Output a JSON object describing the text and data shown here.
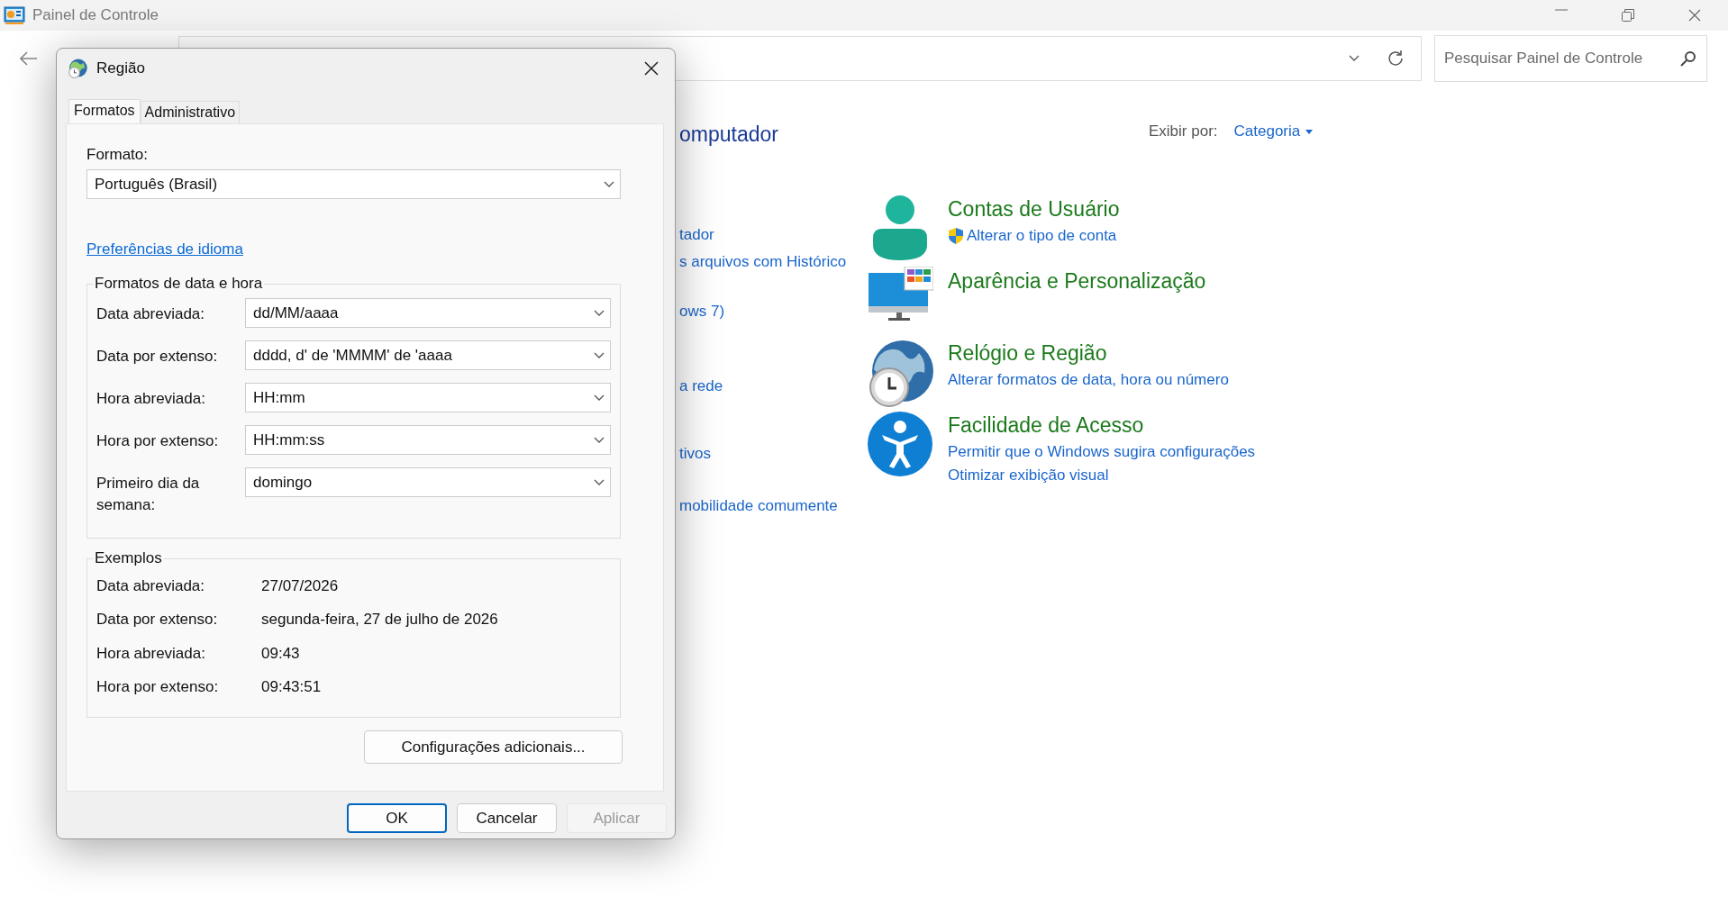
{
  "window": {
    "title": "Painel de Controle"
  },
  "search": {
    "placeholder": "Pesquisar Painel de Controle"
  },
  "heading": "omputador",
  "left_links": [
    "tador",
    "s arquivos com Histórico",
    "ows 7)",
    "a rede",
    "tivos",
    "mobilidade comumente"
  ],
  "view_by": {
    "label": "Exibir por:",
    "value": "Categoria"
  },
  "categories": [
    {
      "kind": "user",
      "title": "Contas de Usuário",
      "links": [
        {
          "text": "Alterar o tipo de conta",
          "shield": true
        }
      ]
    },
    {
      "kind": "display",
      "title": "Aparência e Personalização"
    },
    {
      "kind": "clock",
      "title": "Relógio e Região",
      "links": [
        {
          "text": "Alterar formatos de data, hora ou número",
          "shield": false
        }
      ]
    },
    {
      "kind": "access",
      "title": "Facilidade de Acesso",
      "links": [
        {
          "text": "Permitir que o Windows sugira configurações",
          "shield": false
        },
        {
          "text": "Otimizar exibição visual",
          "shield": false
        }
      ]
    }
  ],
  "dialog": {
    "title": "Região",
    "tabs": [
      {
        "label": "Formatos",
        "selected": true
      },
      {
        "label": "Administrativo",
        "selected": false
      }
    ],
    "format_label": "Formato:",
    "format_value": "Português (Brasil)",
    "link": "Preferências de idioma",
    "formats_group": {
      "title": "Formatos de data e hora",
      "rows": [
        {
          "label": "Data abreviada:",
          "value": "dd/MM/aaaa"
        },
        {
          "label": "Data por extenso:",
          "value": "dddd, d' de 'MMMM' de 'aaaa"
        },
        {
          "label": "Hora abreviada:",
          "value": "HH:mm"
        },
        {
          "label": "Hora por extenso:",
          "value": "HH:mm:ss"
        },
        {
          "label": "Primeiro dia da semana:",
          "value": "domingo"
        }
      ]
    },
    "examples": {
      "title": "Exemplos",
      "rows": [
        {
          "label": "Data abreviada:",
          "value": "27/07/2026"
        },
        {
          "label": "Data por extenso:",
          "value": "segunda-feira, 27 de julho de 2026"
        },
        {
          "label": "Hora abreviada:",
          "value": "09:43"
        },
        {
          "label": "Hora por extenso:",
          "value": "09:43:51"
        }
      ]
    },
    "more_button": "Configurações adicionais...",
    "buttons": [
      {
        "label": "OK",
        "default": true,
        "disabled": false
      },
      {
        "label": "Cancelar",
        "default": false,
        "disabled": false
      },
      {
        "label": "Aplicar",
        "default": false,
        "disabled": true
      }
    ]
  }
}
